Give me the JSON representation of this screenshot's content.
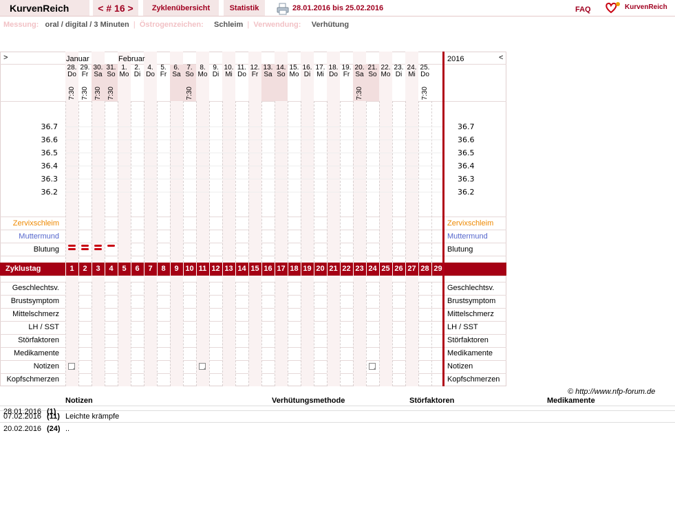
{
  "header": {
    "app_title": "KurvenReich",
    "cycle_number": "< # 16 >",
    "tab_overview": "Zyklenübersicht",
    "tab_statistics": "Statistik",
    "date_range": "28.01.2016 bis 25.02.2016",
    "faq": "FAQ",
    "logo_text": "KurvenReich"
  },
  "info": {
    "measurement_label": "Messung:",
    "measurement_value": "oral / digital / 3 Minuten",
    "estrogen_label": "Östrogenzeichen:",
    "estrogen_value": "Schleim",
    "use_label": "Verwendung:",
    "use_value": "Verhütung"
  },
  "chart": {
    "nav_prev": ">",
    "nav_next": "<",
    "month_jan": "Januar",
    "month_feb": "Februar",
    "year": "2016",
    "days": [
      {
        "d": "28.",
        "w": "Do",
        "t": "7:30"
      },
      {
        "d": "29.",
        "w": "Fr",
        "t": "7:30"
      },
      {
        "d": "30.",
        "w": "Sa",
        "t": "7:30"
      },
      {
        "d": "31.",
        "w": "So",
        "t": "7:30"
      },
      {
        "d": "1.",
        "w": "Mo",
        "t": ""
      },
      {
        "d": "2.",
        "w": "Di",
        "t": ""
      },
      {
        "d": "4.",
        "w": "Do",
        "t": ""
      },
      {
        "d": "5.",
        "w": "Fr",
        "t": ""
      },
      {
        "d": "6.",
        "w": "Sa",
        "t": ""
      },
      {
        "d": "7.",
        "w": "So",
        "t": "7:30"
      },
      {
        "d": "8.",
        "w": "Mo",
        "t": ""
      },
      {
        "d": "9.",
        "w": "Di",
        "t": ""
      },
      {
        "d": "10.",
        "w": "Mi",
        "t": ""
      },
      {
        "d": "11.",
        "w": "Do",
        "t": ""
      },
      {
        "d": "12.",
        "w": "Fr",
        "t": ""
      },
      {
        "d": "13.",
        "w": "Sa",
        "t": ""
      },
      {
        "d": "14.",
        "w": "So",
        "t": ""
      },
      {
        "d": "15.",
        "w": "Mo",
        "t": ""
      },
      {
        "d": "16.",
        "w": "Di",
        "t": ""
      },
      {
        "d": "17.",
        "w": "Mi",
        "t": ""
      },
      {
        "d": "18.",
        "w": "Do",
        "t": ""
      },
      {
        "d": "19.",
        "w": "Fr",
        "t": ""
      },
      {
        "d": "20.",
        "w": "Sa",
        "t": "7:30"
      },
      {
        "d": "21.",
        "w": "So",
        "t": ""
      },
      {
        "d": "22.",
        "w": "Mo",
        "t": ""
      },
      {
        "d": "23.",
        "w": "Di",
        "t": ""
      },
      {
        "d": "24.",
        "w": "Mi",
        "t": ""
      },
      {
        "d": "25.",
        "w": "Do",
        "t": "7:30"
      }
    ],
    "weekend_indices": [
      2,
      3,
      8,
      9,
      15,
      16,
      22,
      23
    ],
    "temps": [
      "36.7",
      "36.6",
      "36.5",
      "36.4",
      "36.3",
      "36.2"
    ],
    "row_cervix": "Zervixschleim",
    "row_cervix_pos": "Muttermund",
    "row_bleeding": "Blutung",
    "cycle_day_label": "Zyklustag",
    "cycle_days": [
      "1",
      "2",
      "3",
      "4",
      "5",
      "6",
      "7",
      "8",
      "9",
      "10",
      "11",
      "12",
      "13",
      "14",
      "15",
      "16",
      "17",
      "18",
      "19",
      "20",
      "21",
      "22",
      "23",
      "24",
      "25",
      "26",
      "27",
      "28",
      "29"
    ],
    "bleeding": [
      {
        "day": 1,
        "marks": 2
      },
      {
        "day": 2,
        "marks": 2
      },
      {
        "day": 3,
        "marks": 2
      },
      {
        "day": 4,
        "marks": 1
      }
    ],
    "rows_bottom": [
      "Geschlechtsv.",
      "Brustsymptom",
      "Mittelschmerz",
      "LH / SST",
      "Störfaktoren",
      "Medikamente",
      "Notizen",
      "Kopfschmerzen"
    ],
    "note_days": [
      1,
      11,
      24
    ],
    "colors": {
      "accent": "#a50014",
      "cervix": "#ee8800",
      "cervix_pos": "#5566cc"
    }
  },
  "copyright": "© http://www.nfp-forum.de",
  "notes_table": {
    "headers": [
      "Notizen",
      "Verhütungsmethode",
      "Störfaktoren",
      "Medikamente"
    ],
    "rows": [
      {
        "date": "28.01.2016",
        "day": "(1)",
        "text": ""
      },
      {
        "date": "07.02.2016",
        "day": "(11)",
        "text": "Leichte krämpfe"
      },
      {
        "date": "20.02.2016",
        "day": "(24)",
        "text": ".."
      }
    ]
  }
}
